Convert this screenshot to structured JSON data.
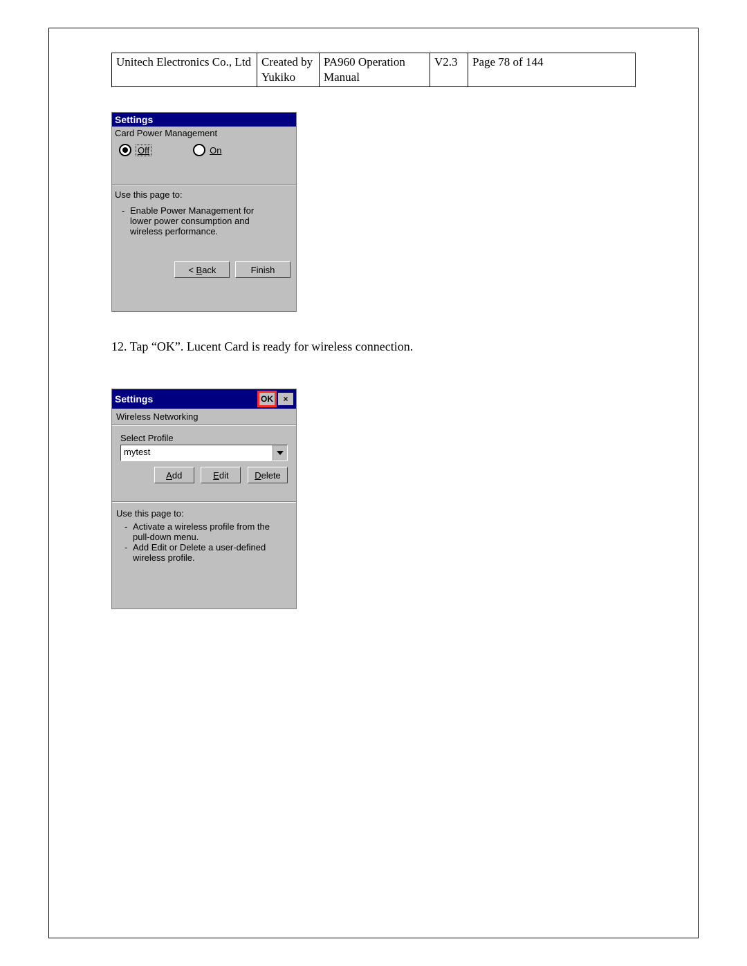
{
  "header": {
    "company": "Unitech Electronics Co., Ltd",
    "created": "Created by Yukiko",
    "manual": "PA960 Operation Manual",
    "version": "V2.3",
    "page": "Page 78 of 144"
  },
  "dialog1": {
    "title": "Settings",
    "subtitle": "Card Power Management",
    "radio_off": "Off",
    "radio_on": "On",
    "use_this_page_to": "Use this page to:",
    "bullet1": "Enable Power Management for lower power consumption and wireless performance.",
    "back_btn": "< Back",
    "finish_btn": "Finish"
  },
  "step12": "12. Tap “OK”. Lucent Card is ready for wireless connection.",
  "dialog2": {
    "title": "Settings",
    "ok_btn": "OK",
    "close_btn": "×",
    "subtitle": "Wireless Networking",
    "select_profile": "Select Profile",
    "profile_value": "mytest",
    "add_btn": "Add",
    "edit_btn": "Edit",
    "delete_btn": "Delete",
    "use_this_page_to": "Use this page to:",
    "bullet1": "Activate a wireless profile from the pull-down menu.",
    "bullet2": "Add Edit or Delete a user-defined wireless profile."
  }
}
